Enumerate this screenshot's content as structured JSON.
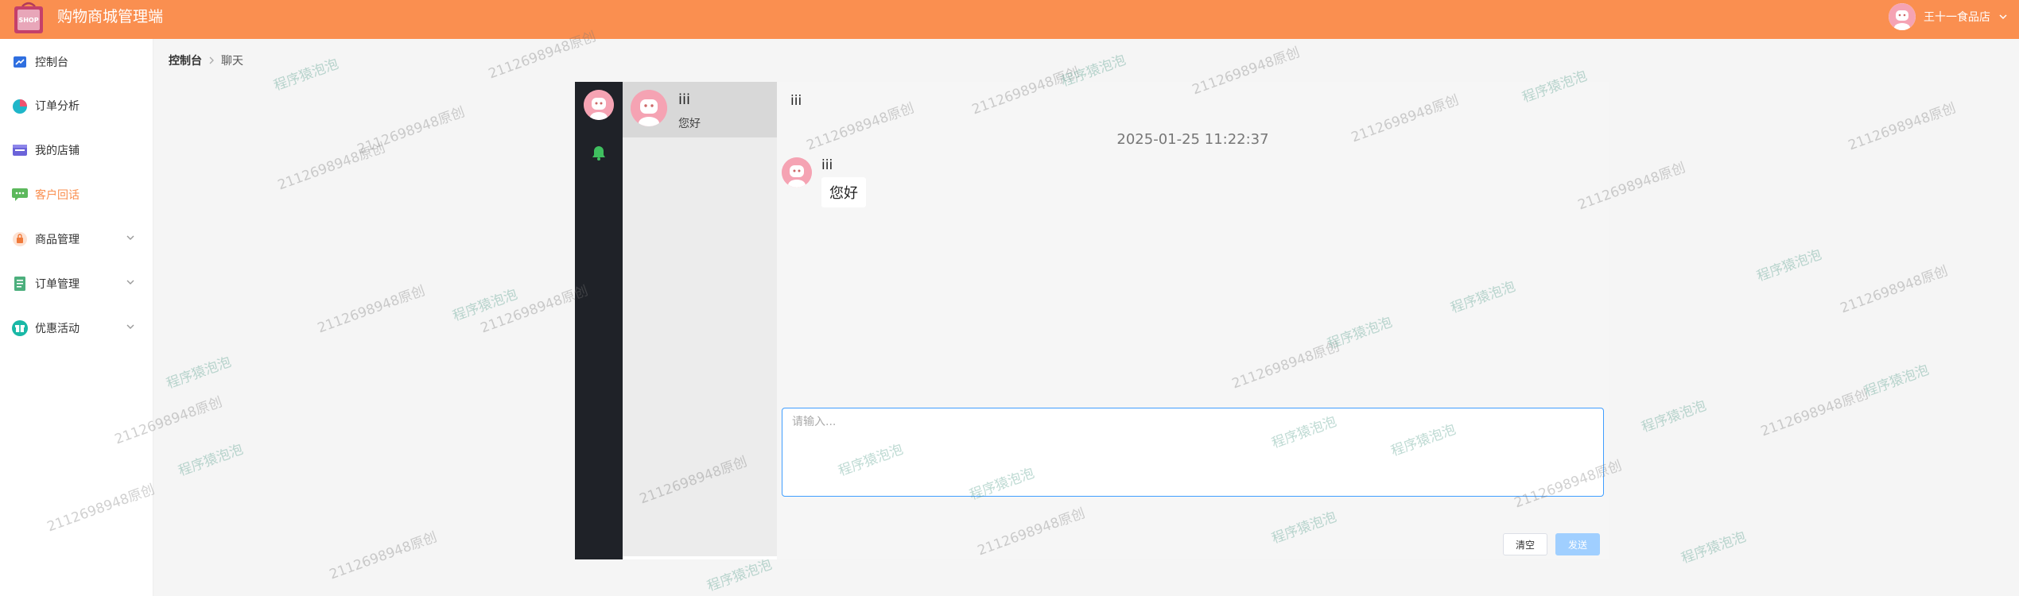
{
  "app": {
    "title": "购物商城管理端",
    "logo_text": "SHOP",
    "brand_color": "#fa8f50",
    "user_name": "王十一食品店"
  },
  "sidebar": {
    "items": [
      {
        "label": "控制台",
        "icon": "chart-line-icon",
        "has_children": false,
        "active": false
      },
      {
        "label": "订单分析",
        "icon": "pie-chart-icon",
        "has_children": false,
        "active": false
      },
      {
        "label": "我的店铺",
        "icon": "store-icon",
        "has_children": false,
        "active": false
      },
      {
        "label": "客户回话",
        "icon": "chat-bubble-icon",
        "has_children": false,
        "active": true
      },
      {
        "label": "商品管理",
        "icon": "bag-icon",
        "has_children": true,
        "active": false
      },
      {
        "label": "订单管理",
        "icon": "list-doc-icon",
        "has_children": true,
        "active": false
      },
      {
        "label": "优惠活动",
        "icon": "gift-icon",
        "has_children": true,
        "active": false
      }
    ]
  },
  "breadcrumb": {
    "home": "控制台",
    "current": "聊天"
  },
  "chat": {
    "conversations": [
      {
        "name": "iii",
        "last_message": "您好"
      }
    ],
    "active": {
      "title": "iii",
      "timestamp": "2025-01-25 11:22:37",
      "messages": [
        {
          "sender": "iii",
          "text": "您好"
        }
      ]
    },
    "input_placeholder": "请输入...",
    "clear_label": "清空",
    "send_label": "发送"
  },
  "watermark": {
    "id_text": "2112698948原创",
    "cn_text": "程序猿泡泡"
  }
}
